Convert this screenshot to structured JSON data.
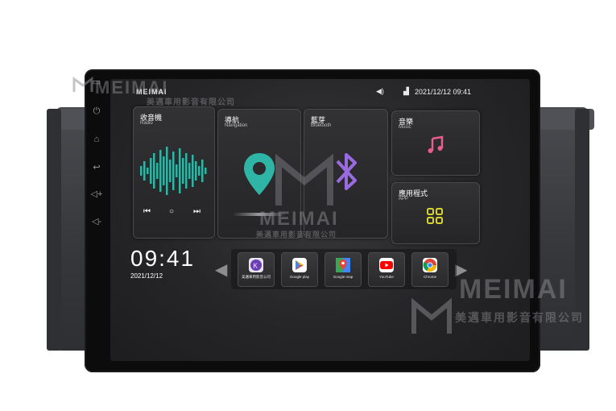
{
  "status_bar": {
    "brand": "MEIMAI",
    "datetime": "2021/12/12 09:41"
  },
  "cards": {
    "radio": {
      "title": "收音機",
      "subtitle": "Radio"
    },
    "navigation": {
      "title": "導航",
      "subtitle": "Navigation"
    },
    "bluetooth": {
      "title": "藍芽",
      "subtitle": "Bluetooth"
    },
    "music": {
      "title": "音樂",
      "subtitle": "Music"
    },
    "apps": {
      "title": "應用程式",
      "subtitle": "APP"
    }
  },
  "clock": {
    "time": "09:41",
    "date": "2021/12/12"
  },
  "dock": [
    {
      "label": "美邁車用影音公司",
      "icon": "kk-app-icon"
    },
    {
      "label": "Google play",
      "icon": "play-store-icon"
    },
    {
      "label": "Google map",
      "icon": "maps-icon"
    },
    {
      "label": "YouTube",
      "icon": "youtube-icon"
    },
    {
      "label": "Chrome",
      "icon": "chrome-icon"
    }
  ],
  "watermark": {
    "brand": "MEIMAI",
    "company": "美邁車用影音有限公司"
  },
  "colors": {
    "accent_teal": "#2fb5a5",
    "bluetooth_purple": "#9a6be0",
    "music_pink": "#e85d8a",
    "apps_yellow": "#d8d22e"
  }
}
